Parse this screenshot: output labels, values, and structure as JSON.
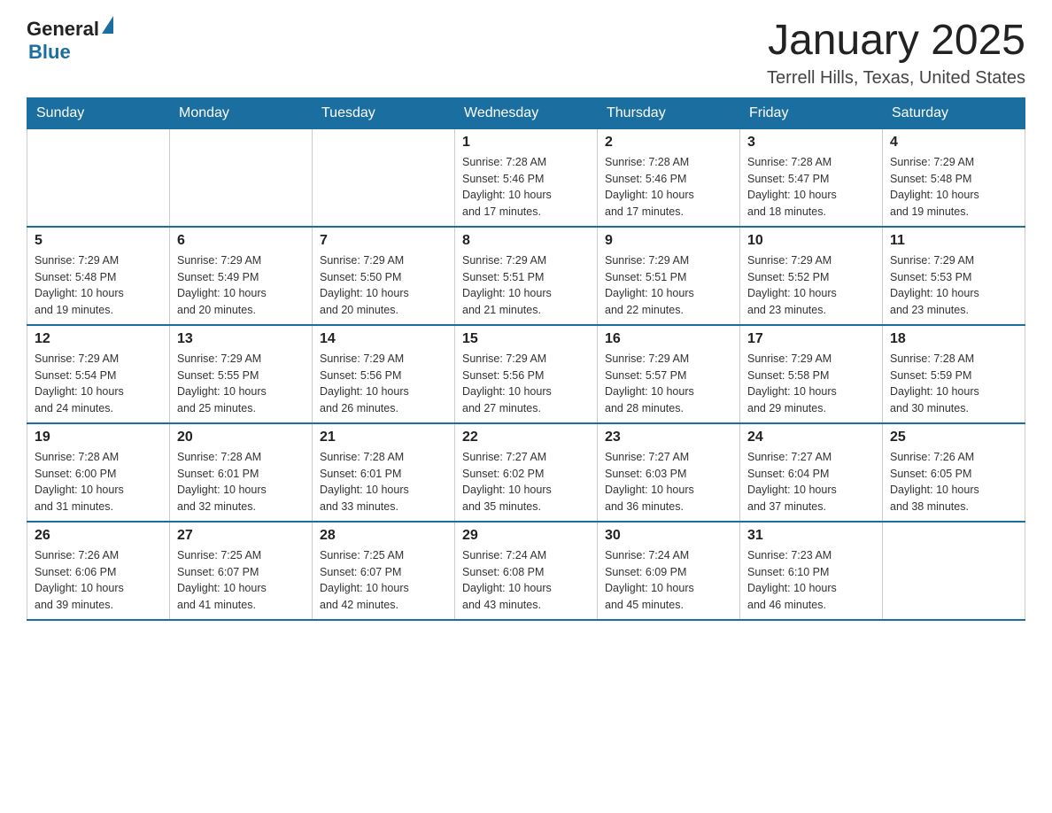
{
  "logo": {
    "text_general": "General",
    "text_blue": "Blue",
    "triangle": "▲"
  },
  "title": "January 2025",
  "subtitle": "Terrell Hills, Texas, United States",
  "days_of_week": [
    "Sunday",
    "Monday",
    "Tuesday",
    "Wednesday",
    "Thursday",
    "Friday",
    "Saturday"
  ],
  "weeks": [
    [
      {
        "day": "",
        "info": ""
      },
      {
        "day": "",
        "info": ""
      },
      {
        "day": "",
        "info": ""
      },
      {
        "day": "1",
        "info": "Sunrise: 7:28 AM\nSunset: 5:46 PM\nDaylight: 10 hours\nand 17 minutes."
      },
      {
        "day": "2",
        "info": "Sunrise: 7:28 AM\nSunset: 5:46 PM\nDaylight: 10 hours\nand 17 minutes."
      },
      {
        "day": "3",
        "info": "Sunrise: 7:28 AM\nSunset: 5:47 PM\nDaylight: 10 hours\nand 18 minutes."
      },
      {
        "day": "4",
        "info": "Sunrise: 7:29 AM\nSunset: 5:48 PM\nDaylight: 10 hours\nand 19 minutes."
      }
    ],
    [
      {
        "day": "5",
        "info": "Sunrise: 7:29 AM\nSunset: 5:48 PM\nDaylight: 10 hours\nand 19 minutes."
      },
      {
        "day": "6",
        "info": "Sunrise: 7:29 AM\nSunset: 5:49 PM\nDaylight: 10 hours\nand 20 minutes."
      },
      {
        "day": "7",
        "info": "Sunrise: 7:29 AM\nSunset: 5:50 PM\nDaylight: 10 hours\nand 20 minutes."
      },
      {
        "day": "8",
        "info": "Sunrise: 7:29 AM\nSunset: 5:51 PM\nDaylight: 10 hours\nand 21 minutes."
      },
      {
        "day": "9",
        "info": "Sunrise: 7:29 AM\nSunset: 5:51 PM\nDaylight: 10 hours\nand 22 minutes."
      },
      {
        "day": "10",
        "info": "Sunrise: 7:29 AM\nSunset: 5:52 PM\nDaylight: 10 hours\nand 23 minutes."
      },
      {
        "day": "11",
        "info": "Sunrise: 7:29 AM\nSunset: 5:53 PM\nDaylight: 10 hours\nand 23 minutes."
      }
    ],
    [
      {
        "day": "12",
        "info": "Sunrise: 7:29 AM\nSunset: 5:54 PM\nDaylight: 10 hours\nand 24 minutes."
      },
      {
        "day": "13",
        "info": "Sunrise: 7:29 AM\nSunset: 5:55 PM\nDaylight: 10 hours\nand 25 minutes."
      },
      {
        "day": "14",
        "info": "Sunrise: 7:29 AM\nSunset: 5:56 PM\nDaylight: 10 hours\nand 26 minutes."
      },
      {
        "day": "15",
        "info": "Sunrise: 7:29 AM\nSunset: 5:56 PM\nDaylight: 10 hours\nand 27 minutes."
      },
      {
        "day": "16",
        "info": "Sunrise: 7:29 AM\nSunset: 5:57 PM\nDaylight: 10 hours\nand 28 minutes."
      },
      {
        "day": "17",
        "info": "Sunrise: 7:29 AM\nSunset: 5:58 PM\nDaylight: 10 hours\nand 29 minutes."
      },
      {
        "day": "18",
        "info": "Sunrise: 7:28 AM\nSunset: 5:59 PM\nDaylight: 10 hours\nand 30 minutes."
      }
    ],
    [
      {
        "day": "19",
        "info": "Sunrise: 7:28 AM\nSunset: 6:00 PM\nDaylight: 10 hours\nand 31 minutes."
      },
      {
        "day": "20",
        "info": "Sunrise: 7:28 AM\nSunset: 6:01 PM\nDaylight: 10 hours\nand 32 minutes."
      },
      {
        "day": "21",
        "info": "Sunrise: 7:28 AM\nSunset: 6:01 PM\nDaylight: 10 hours\nand 33 minutes."
      },
      {
        "day": "22",
        "info": "Sunrise: 7:27 AM\nSunset: 6:02 PM\nDaylight: 10 hours\nand 35 minutes."
      },
      {
        "day": "23",
        "info": "Sunrise: 7:27 AM\nSunset: 6:03 PM\nDaylight: 10 hours\nand 36 minutes."
      },
      {
        "day": "24",
        "info": "Sunrise: 7:27 AM\nSunset: 6:04 PM\nDaylight: 10 hours\nand 37 minutes."
      },
      {
        "day": "25",
        "info": "Sunrise: 7:26 AM\nSunset: 6:05 PM\nDaylight: 10 hours\nand 38 minutes."
      }
    ],
    [
      {
        "day": "26",
        "info": "Sunrise: 7:26 AM\nSunset: 6:06 PM\nDaylight: 10 hours\nand 39 minutes."
      },
      {
        "day": "27",
        "info": "Sunrise: 7:25 AM\nSunset: 6:07 PM\nDaylight: 10 hours\nand 41 minutes."
      },
      {
        "day": "28",
        "info": "Sunrise: 7:25 AM\nSunset: 6:07 PM\nDaylight: 10 hours\nand 42 minutes."
      },
      {
        "day": "29",
        "info": "Sunrise: 7:24 AM\nSunset: 6:08 PM\nDaylight: 10 hours\nand 43 minutes."
      },
      {
        "day": "30",
        "info": "Sunrise: 7:24 AM\nSunset: 6:09 PM\nDaylight: 10 hours\nand 45 minutes."
      },
      {
        "day": "31",
        "info": "Sunrise: 7:23 AM\nSunset: 6:10 PM\nDaylight: 10 hours\nand 46 minutes."
      },
      {
        "day": "",
        "info": ""
      }
    ]
  ]
}
